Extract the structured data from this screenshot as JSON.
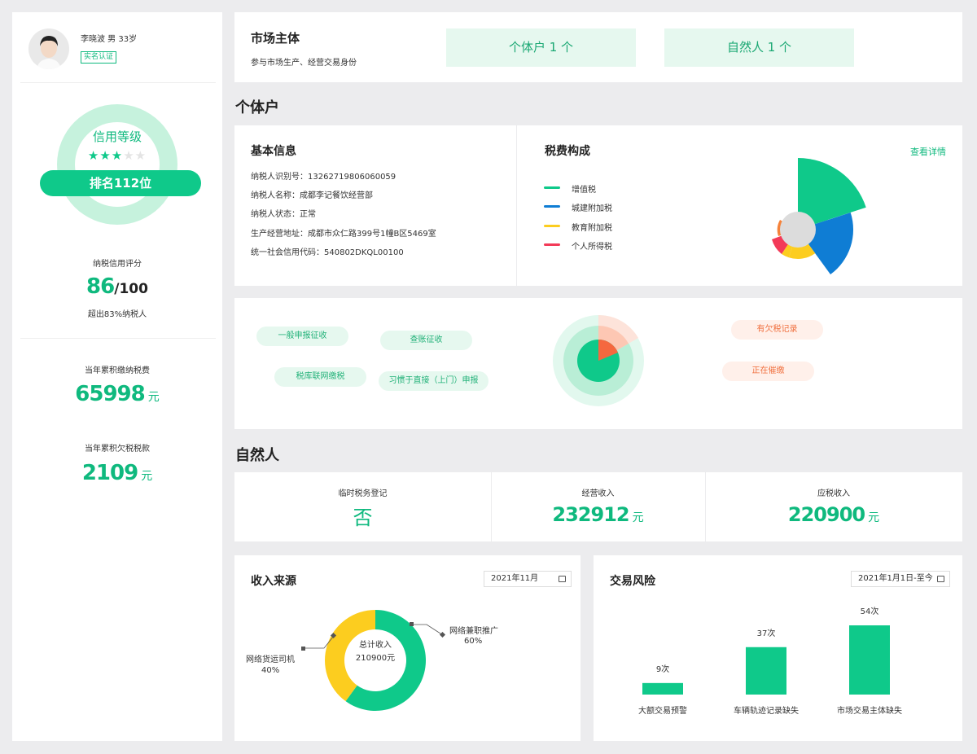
{
  "profile": {
    "name_line": "李晓波 男 33岁",
    "verified_badge": "实名认证",
    "credit_title": "信用等级",
    "stars_filled": 3,
    "stars_total": 5,
    "rank": "排名112位",
    "score_label": "纳税信用评分",
    "score": "86",
    "score_total": "/100",
    "score_note": "超出83%纳税人",
    "paid_label": "当年累积缴纳税费",
    "paid_value": "65998",
    "paid_unit": "元",
    "owed_label": "当年累积欠税税款",
    "owed_value": "2109",
    "owed_unit": "元"
  },
  "market": {
    "title": "市场主体",
    "subtitle": "参与市场生产、经营交易身份",
    "btn_individual": "个体户 1 个",
    "btn_natural": "自然人 1 个"
  },
  "individual": {
    "section_title": "个体户",
    "basic_title": "基本信息",
    "lines": [
      "纳税人识别号：13262719806060059",
      "纳税人名称：成都李记餐饮经营部",
      "纳税人状态：正常",
      "生产经营地址：成都市众仁路399号1幢B区5469室",
      "统一社会信用代码：540802DKQL00100"
    ],
    "tax_title": "税费构成",
    "tax_detail_link": "查看详情",
    "tax_legend": [
      {
        "name": "增值税",
        "color": "#0fc98a"
      },
      {
        "name": "城建附加税",
        "color": "#0f7dd4"
      },
      {
        "name": "教育附加税",
        "color": "#fccd1f"
      },
      {
        "name": "个人所得税",
        "color": "#f33a58"
      }
    ],
    "tags_green": [
      "一般申报征收",
      "查账征收",
      "税库联网缴税",
      "习惯于直接（上门）申报"
    ],
    "tags_orange": [
      "有欠税记录",
      "正在催缴"
    ]
  },
  "natural": {
    "section_title": "自然人",
    "stats": [
      {
        "label": "临时税务登记",
        "value": "否",
        "unit": ""
      },
      {
        "label": "经营收入",
        "value": "232912",
        "unit": "元"
      },
      {
        "label": "应税收入",
        "value": "220900",
        "unit": "元"
      }
    ]
  },
  "income": {
    "title": "收入来源",
    "date": "2021年11月",
    "center_label": "总计收入",
    "center_value": "210900元",
    "slices": [
      {
        "name": "网络兼职推广",
        "pct": "60%",
        "value": 60,
        "color": "#0fc98a"
      },
      {
        "name": "网络货运司机",
        "pct": "40%",
        "value": 40,
        "color": "#fccd1f"
      }
    ]
  },
  "risk": {
    "title": "交易风险",
    "date": "2021年1月1日-至今",
    "bars": [
      {
        "name": "大额交易预警",
        "value": 9,
        "label": "9次"
      },
      {
        "name": "车辆轨迹记录缺失",
        "value": 37,
        "label": "37次"
      },
      {
        "name": "市场交易主体缺失",
        "value": 54,
        "label": "54次"
      }
    ],
    "bar_color": "#0fc98a"
  },
  "chart_data": [
    {
      "type": "pie",
      "title": "收入来源",
      "categories": [
        "网络兼职推广",
        "网络货运司机"
      ],
      "values": [
        60,
        40
      ]
    },
    {
      "type": "bar",
      "title": "交易风险",
      "categories": [
        "大额交易预警",
        "车辆轨迹记录缺失",
        "市场交易主体缺失"
      ],
      "values": [
        9,
        37,
        54
      ]
    }
  ]
}
